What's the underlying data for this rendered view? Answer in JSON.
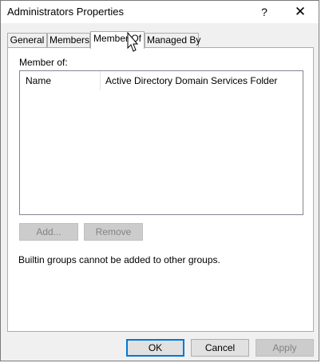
{
  "window": {
    "title": "Administrators Properties",
    "help_symbol": "?",
    "close_symbol": "✕"
  },
  "tabs": [
    {
      "label": "General"
    },
    {
      "label": "Members"
    },
    {
      "label": "Member Of",
      "active": true
    },
    {
      "label": "Managed By"
    }
  ],
  "member_of": {
    "label": "Member of:",
    "columns": [
      "Name",
      "Active Directory Domain Services Folder"
    ],
    "rows": [],
    "add_label": "Add...",
    "remove_label": "Remove",
    "note": "Builtin groups cannot be added to other groups."
  },
  "footer": {
    "ok_label": "OK",
    "cancel_label": "Cancel",
    "apply_label": "Apply"
  },
  "colors": {
    "accent": "#0078d7",
    "panel_bg": "#ffffff",
    "dialog_bg": "#f0f0f0"
  },
  "icons": [
    "help-icon",
    "close-icon",
    "mouse-pointer-icon"
  ]
}
